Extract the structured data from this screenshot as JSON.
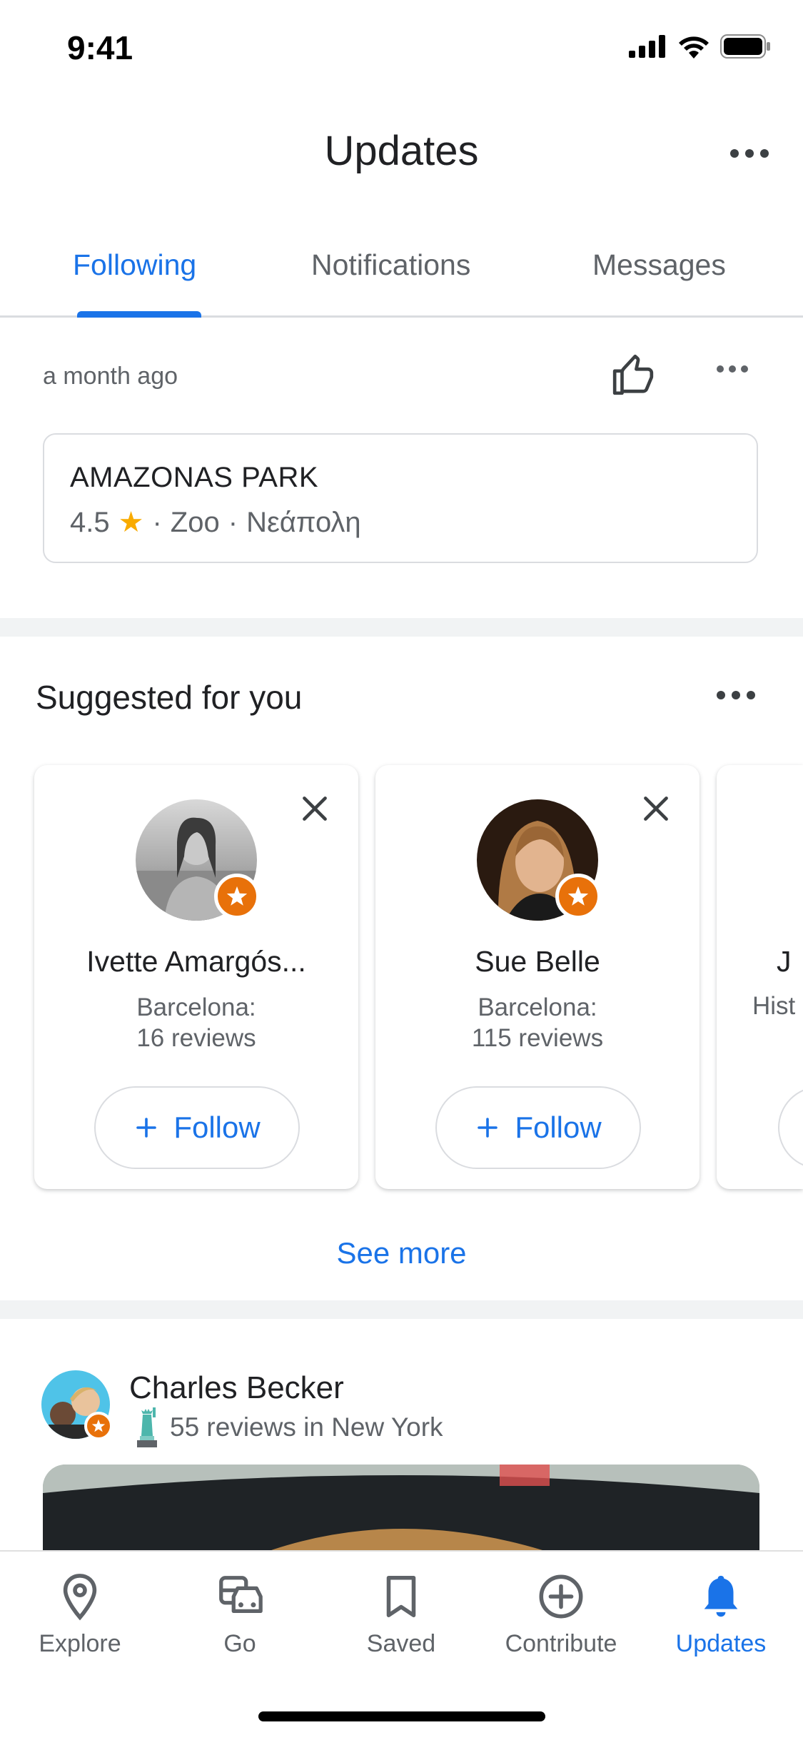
{
  "status_bar": {
    "time": "9:41"
  },
  "header": {
    "title": "Updates"
  },
  "tabs": [
    {
      "label": "Following",
      "active": true
    },
    {
      "label": "Notifications",
      "active": false
    },
    {
      "label": "Messages",
      "active": false
    }
  ],
  "post": {
    "time_ago": "a month ago",
    "place": {
      "name": "AMAZONAS PARK",
      "rating": "4.5",
      "category": "Zoo",
      "area": "Νεάπολη"
    }
  },
  "suggested": {
    "title": "Suggested for you",
    "cards": [
      {
        "name": "Ivette Amargós...",
        "location": "Barcelona:",
        "reviews": "16 reviews",
        "follow_label": "Follow"
      },
      {
        "name": "Sue Belle",
        "location": "Barcelona:",
        "reviews": "115 reviews",
        "follow_label": "Follow"
      },
      {
        "name": "J",
        "location": "Hist",
        "reviews": "",
        "follow_label": ""
      }
    ],
    "see_more": "See more"
  },
  "feed_item": {
    "name": "Charles Becker",
    "subtitle": "55 reviews in New York"
  },
  "bottom_nav": [
    {
      "label": "Explore",
      "icon": "pin-icon",
      "active": false
    },
    {
      "label": "Go",
      "icon": "commute-icon",
      "active": false
    },
    {
      "label": "Saved",
      "icon": "bookmark-icon",
      "active": false
    },
    {
      "label": "Contribute",
      "icon": "add-circle-icon",
      "active": false
    },
    {
      "label": "Updates",
      "icon": "bell-icon",
      "active": true
    }
  ],
  "colors": {
    "accent": "#1a73e8",
    "badge": "#e8710a",
    "star": "#f9ab00"
  }
}
